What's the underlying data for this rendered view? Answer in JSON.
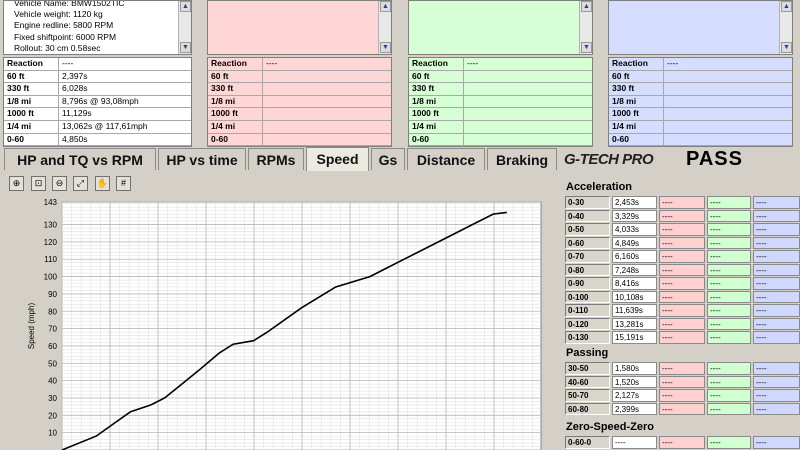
{
  "colors": {
    "run1": "#ffffff",
    "run2": "#ffd6d6",
    "run3": "#d6ffd6",
    "run4": "#d6deff",
    "accent": "#000000"
  },
  "info": {
    "lines": [
      "Vehicle Name: BMW1502TIC",
      "Vehicle weight: 1120 kg",
      "Engine redline: 5800 RPM",
      "Fixed shiftpoint: 6000 RPM",
      "Rollout: 30 cm  0.58sec"
    ]
  },
  "reaction": {
    "labels": [
      "Reaction",
      "60 ft",
      "330 ft",
      "1/8 mi",
      "1000 ft",
      "1/4 mi",
      "0-60"
    ],
    "run1": [
      "----",
      "2,397s",
      "6,028s",
      "8,796s @ 93,08mph",
      "11,129s",
      "13,062s @ 117,61mph",
      "4,850s"
    ],
    "other": [
      "----",
      "",
      "",
      "",
      "",
      "",
      ""
    ]
  },
  "tabs": [
    {
      "label": "HP and TQ vs RPM"
    },
    {
      "label": "HP vs time"
    },
    {
      "label": "RPMs"
    },
    {
      "label": "Speed"
    },
    {
      "label": "Gs"
    },
    {
      "label": "Distance"
    },
    {
      "label": "Braking"
    }
  ],
  "brand": {
    "logo": "G-TECH PRO",
    "pass": "PASS"
  },
  "toolbar": {
    "icons": [
      "zoom-in-icon",
      "zoom-box-icon",
      "zoom-out-icon",
      "fit-icon",
      "pan-icon",
      "grid-icon"
    ]
  },
  "chart_data": {
    "type": "line",
    "ylabel": "Speed (mph)",
    "xlabel": "",
    "ylim": [
      0,
      143
    ],
    "yticks": [
      143,
      130,
      120,
      110,
      100,
      90,
      80,
      70,
      60,
      50,
      40,
      30,
      20,
      10
    ],
    "series": [
      {
        "values_x": [
          0,
          1,
          2,
          2.6,
          3,
          3.5,
          4,
          4.6,
          5,
          5.6,
          6,
          7,
          8,
          9,
          10,
          11,
          12,
          12.6,
          13
        ],
        "values_y": [
          0,
          8,
          22,
          26,
          30,
          38,
          46,
          56,
          61,
          63,
          68,
          82,
          94,
          100,
          110,
          120,
          130,
          136,
          137
        ]
      }
    ],
    "xlim": [
      0,
      14
    ],
    "color": "#000000"
  },
  "acceleration": {
    "title": "Acceleration",
    "rows": [
      {
        "label": "0-30",
        "v": "2,453s"
      },
      {
        "label": "0-40",
        "v": "3,329s"
      },
      {
        "label": "0-50",
        "v": "4,033s"
      },
      {
        "label": "0-60",
        "v": "4,849s"
      },
      {
        "label": "0-70",
        "v": "6,160s"
      },
      {
        "label": "0-80",
        "v": "7,248s"
      },
      {
        "label": "0-90",
        "v": "8,416s"
      },
      {
        "label": "0-100",
        "v": "10,108s"
      },
      {
        "label": "0-110",
        "v": "11,639s"
      },
      {
        "label": "0-120",
        "v": "13,281s"
      },
      {
        "label": "0-130",
        "v": "15,191s"
      }
    ]
  },
  "passing": {
    "title": "Passing",
    "rows": [
      {
        "label": "30-50",
        "v": "1,580s"
      },
      {
        "label": "40-60",
        "v": "1,520s"
      },
      {
        "label": "50-70",
        "v": "2,127s"
      },
      {
        "label": "60-80",
        "v": "2,399s"
      }
    ]
  },
  "zsz": {
    "title": "Zero-Speed-Zero",
    "rows": [
      {
        "label": "0-60-0",
        "v": "----"
      }
    ]
  },
  "dash": "----"
}
